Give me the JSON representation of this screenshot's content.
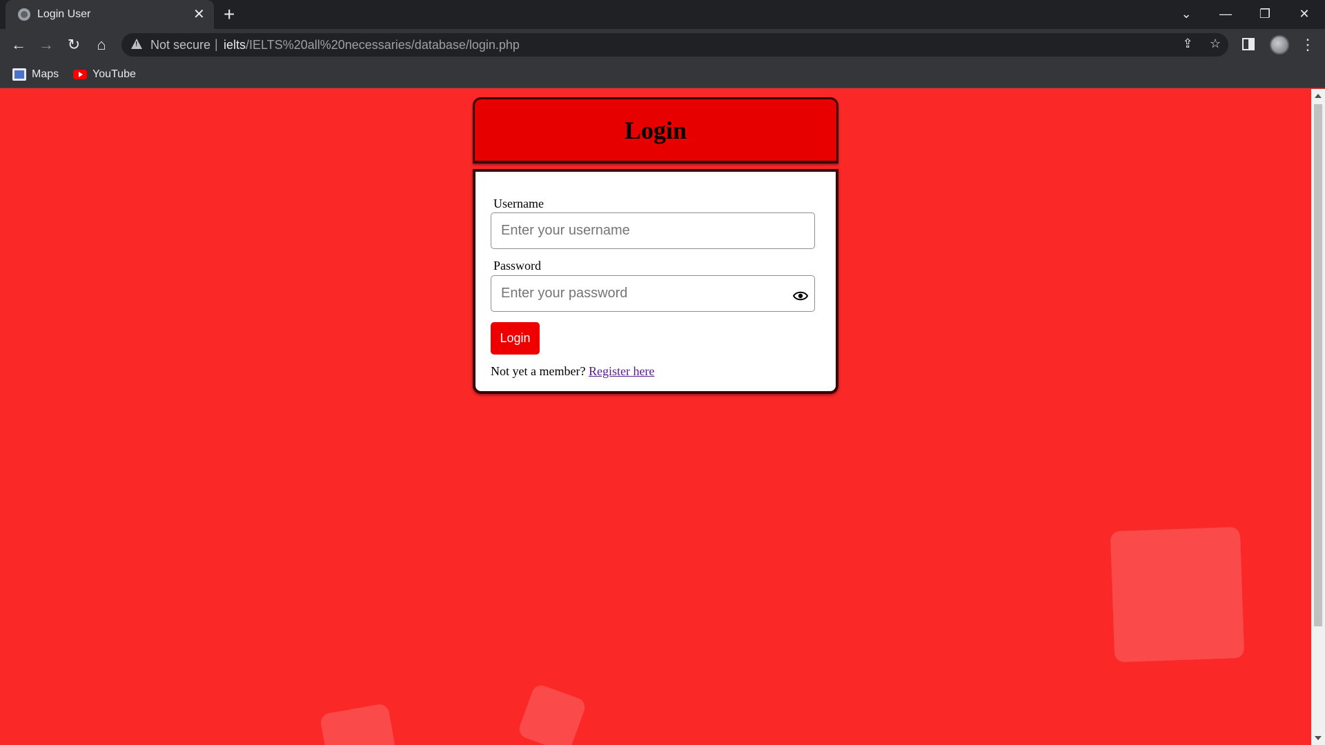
{
  "browser": {
    "tab_title": "Login User",
    "tab_close": "✕",
    "new_tab": "+",
    "security_label": "Not secure",
    "url_host": "ielts",
    "url_path": "/IELTS%20all%20necessaries/database/login.php",
    "bookmarks": [
      {
        "label": "Maps",
        "icon": "maps-icon"
      },
      {
        "label": "YouTube",
        "icon": "youtube-icon"
      }
    ],
    "window_controls": {
      "dropdown": "⌄",
      "minimize": "—",
      "restore": "❐",
      "close": "✕"
    },
    "nav": {
      "back": "←",
      "forward": "→",
      "reload": "↻",
      "home": "⌂"
    },
    "omnibox_icons": {
      "share": "⇪",
      "bookmark": "☆"
    },
    "menu": "⋮"
  },
  "login": {
    "title": "Login",
    "username_label": "Username",
    "username_placeholder": "Enter your username",
    "password_label": "Password",
    "password_placeholder": "Enter your password",
    "button_label": "Login",
    "register_prompt": "Not yet a member?",
    "register_link": "Register here"
  },
  "colors": {
    "page_background": "#fb2828",
    "header_background": "#e60000",
    "button_background": "#ee0000"
  }
}
